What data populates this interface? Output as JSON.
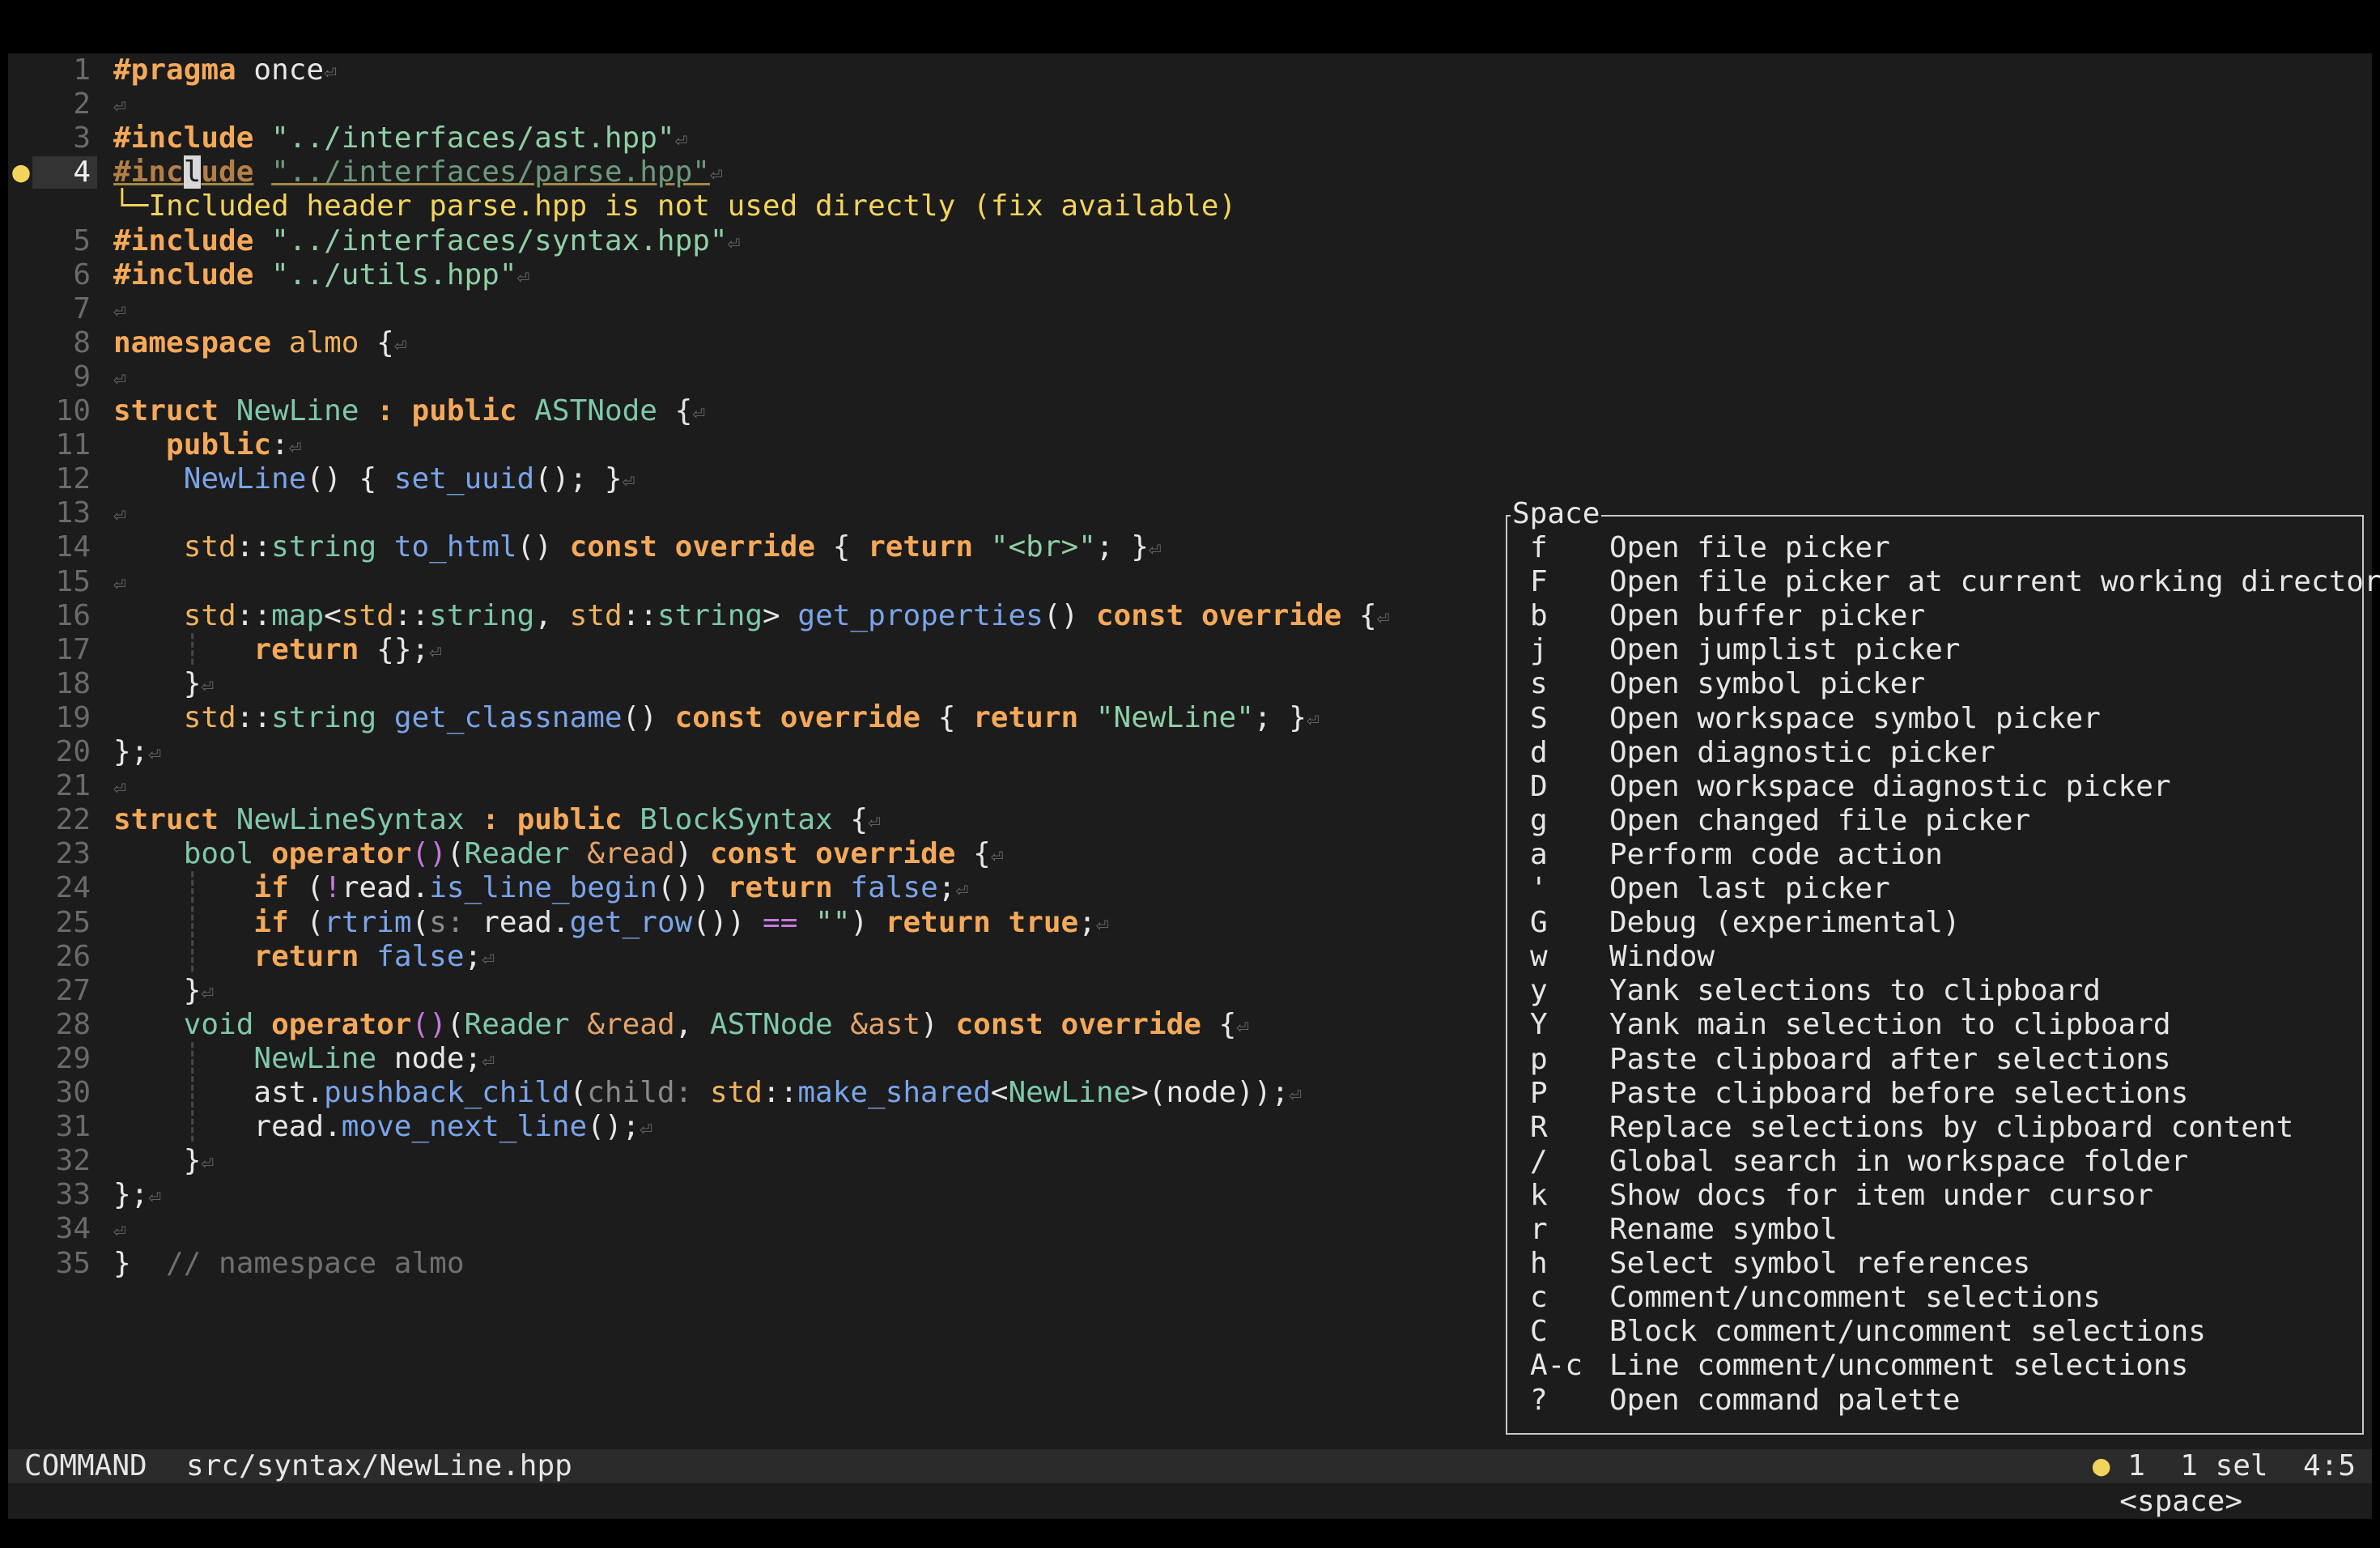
{
  "editor": {
    "current_line": "4",
    "diagnostic_marker": "●",
    "diagnostic_message": "└─Included header parse.hpp is not used directly (fix available)",
    "eol_symbol": "⏎"
  },
  "code_lines": [
    {
      "n": "1",
      "tokens": [
        [
          "kw",
          "#pragma"
        ],
        [
          "pl",
          " once"
        ]
      ]
    },
    {
      "n": "2",
      "tokens": []
    },
    {
      "n": "3",
      "tokens": [
        [
          "kw",
          "#include"
        ],
        [
          "pl",
          " "
        ],
        [
          "st",
          "\"../interfaces/ast.hpp\""
        ]
      ]
    },
    {
      "n": "4",
      "tokens": [
        [
          "kw dim ul",
          "#inc"
        ],
        [
          "cursor",
          "l"
        ],
        [
          "kw dim ul",
          "ude"
        ],
        [
          "pl",
          " "
        ],
        [
          "st dim ul",
          "\"../interfaces/parse.hpp\""
        ]
      ]
    },
    {
      "n": "5",
      "tokens": [
        [
          "kw",
          "#include"
        ],
        [
          "pl",
          " "
        ],
        [
          "st",
          "\"../interfaces/syntax.hpp\""
        ]
      ]
    },
    {
      "n": "6",
      "tokens": [
        [
          "kw",
          "#include"
        ],
        [
          "pl",
          " "
        ],
        [
          "st",
          "\"../utils.hpp\""
        ]
      ]
    },
    {
      "n": "7",
      "tokens": []
    },
    {
      "n": "8",
      "tokens": [
        [
          "kw",
          "namespace"
        ],
        [
          "pl",
          " "
        ],
        [
          "ns",
          "almo"
        ],
        [
          "pl",
          " {"
        ]
      ]
    },
    {
      "n": "9",
      "tokens": []
    },
    {
      "n": "10",
      "tokens": [
        [
          "kw",
          "struct"
        ],
        [
          "pl",
          " "
        ],
        [
          "ty",
          "NewLine"
        ],
        [
          "pl",
          " "
        ],
        [
          "kw",
          ":"
        ],
        [
          "pl",
          " "
        ],
        [
          "kw",
          "public"
        ],
        [
          "pl",
          " "
        ],
        [
          "ty",
          "ASTNode"
        ],
        [
          "pl",
          " {"
        ]
      ]
    },
    {
      "n": "11",
      "tokens": [
        [
          "pl",
          "   "
        ],
        [
          "kw",
          "public"
        ],
        [
          "pl",
          ":"
        ]
      ]
    },
    {
      "n": "12",
      "tokens": [
        [
          "pl",
          "    "
        ],
        [
          "fn",
          "NewLine"
        ],
        [
          "pl",
          "() { "
        ],
        [
          "fn",
          "set_uuid"
        ],
        [
          "pl",
          "(); }"
        ]
      ]
    },
    {
      "n": "13",
      "tokens": []
    },
    {
      "n": "14",
      "tokens": [
        [
          "pl",
          "    "
        ],
        [
          "ns",
          "std"
        ],
        [
          "pl",
          "::"
        ],
        [
          "ty",
          "string"
        ],
        [
          "pl",
          " "
        ],
        [
          "fn",
          "to_html"
        ],
        [
          "pl",
          "() "
        ],
        [
          "kw",
          "const"
        ],
        [
          "pl",
          " "
        ],
        [
          "kw",
          "override"
        ],
        [
          "pl",
          " { "
        ],
        [
          "kw",
          "return"
        ],
        [
          "pl",
          " "
        ],
        [
          "st",
          "\"<br>\""
        ],
        [
          "pl",
          "; }"
        ]
      ]
    },
    {
      "n": "15",
      "tokens": []
    },
    {
      "n": "16",
      "tokens": [
        [
          "pl",
          "    "
        ],
        [
          "ns",
          "std"
        ],
        [
          "pl",
          "::"
        ],
        [
          "ty",
          "map"
        ],
        [
          "pl",
          "<"
        ],
        [
          "ns",
          "std"
        ],
        [
          "pl",
          "::"
        ],
        [
          "ty",
          "string"
        ],
        [
          "pl",
          ", "
        ],
        [
          "ns",
          "std"
        ],
        [
          "pl",
          "::"
        ],
        [
          "ty",
          "string"
        ],
        [
          "pl",
          "> "
        ],
        [
          "fn",
          "get_properties"
        ],
        [
          "pl",
          "() "
        ],
        [
          "kw",
          "const"
        ],
        [
          "pl",
          " "
        ],
        [
          "kw",
          "override"
        ],
        [
          "pl",
          " {"
        ]
      ]
    },
    {
      "n": "17",
      "tokens": [
        [
          "pl",
          "    "
        ],
        [
          "guide",
          "┊"
        ],
        [
          "pl",
          "   "
        ],
        [
          "kw",
          "return"
        ],
        [
          "pl",
          " {};"
        ]
      ]
    },
    {
      "n": "18",
      "tokens": [
        [
          "pl",
          "    }"
        ]
      ]
    },
    {
      "n": "19",
      "tokens": [
        [
          "pl",
          "    "
        ],
        [
          "ns",
          "std"
        ],
        [
          "pl",
          "::"
        ],
        [
          "ty",
          "string"
        ],
        [
          "pl",
          " "
        ],
        [
          "fn",
          "get_classname"
        ],
        [
          "pl",
          "() "
        ],
        [
          "kw",
          "const"
        ],
        [
          "pl",
          " "
        ],
        [
          "kw",
          "override"
        ],
        [
          "pl",
          " { "
        ],
        [
          "kw",
          "return"
        ],
        [
          "pl",
          " "
        ],
        [
          "st",
          "\"NewLine\""
        ],
        [
          "pl",
          "; }"
        ]
      ]
    },
    {
      "n": "20",
      "tokens": [
        [
          "pl",
          "};"
        ]
      ]
    },
    {
      "n": "21",
      "tokens": []
    },
    {
      "n": "22",
      "tokens": [
        [
          "kw",
          "struct"
        ],
        [
          "pl",
          " "
        ],
        [
          "ty",
          "NewLineSyntax"
        ],
        [
          "pl",
          " "
        ],
        [
          "kw",
          ":"
        ],
        [
          "pl",
          " "
        ],
        [
          "kw",
          "public"
        ],
        [
          "pl",
          " "
        ],
        [
          "ty",
          "BlockSyntax"
        ],
        [
          "pl",
          " {"
        ]
      ]
    },
    {
      "n": "23",
      "tokens": [
        [
          "pl",
          "    "
        ],
        [
          "ty",
          "bool"
        ],
        [
          "pl",
          " "
        ],
        [
          "kw",
          "operator"
        ],
        [
          "op",
          "()"
        ],
        [
          "pl",
          "("
        ],
        [
          "ty",
          "Reader"
        ],
        [
          "pl",
          " "
        ],
        [
          "pm",
          "&read"
        ],
        [
          "pl",
          ") "
        ],
        [
          "kw",
          "const"
        ],
        [
          "pl",
          " "
        ],
        [
          "kw",
          "override"
        ],
        [
          "pl",
          " {"
        ]
      ]
    },
    {
      "n": "24",
      "tokens": [
        [
          "pl",
          "    "
        ],
        [
          "guide",
          "┊"
        ],
        [
          "pl",
          "   "
        ],
        [
          "kw",
          "if"
        ],
        [
          "pl",
          " ("
        ],
        [
          "op",
          "!"
        ],
        [
          "pl",
          "read."
        ],
        [
          "fn",
          "is_line_begin"
        ],
        [
          "pl",
          "()) "
        ],
        [
          "kw",
          "return"
        ],
        [
          "pl",
          " "
        ],
        [
          "fn",
          "false"
        ],
        [
          "pl",
          ";"
        ]
      ]
    },
    {
      "n": "25",
      "tokens": [
        [
          "pl",
          "    "
        ],
        [
          "guide",
          "┊"
        ],
        [
          "pl",
          "   "
        ],
        [
          "kw",
          "if"
        ],
        [
          "pl",
          " ("
        ],
        [
          "fn",
          "rtrim"
        ],
        [
          "pl",
          "("
        ],
        [
          "hint",
          "s: "
        ],
        [
          "pl",
          "read."
        ],
        [
          "fn",
          "get_row"
        ],
        [
          "pl",
          "()) "
        ],
        [
          "op",
          "=="
        ],
        [
          "pl",
          " "
        ],
        [
          "st",
          "\"\""
        ],
        [
          "pl",
          ") "
        ],
        [
          "kw",
          "return"
        ],
        [
          "pl",
          " "
        ],
        [
          "kw",
          "true"
        ],
        [
          "pl",
          ";"
        ]
      ]
    },
    {
      "n": "26",
      "tokens": [
        [
          "pl",
          "    "
        ],
        [
          "guide",
          "┊"
        ],
        [
          "pl",
          "   "
        ],
        [
          "kw",
          "return"
        ],
        [
          "pl",
          " "
        ],
        [
          "fn",
          "false"
        ],
        [
          "pl",
          ";"
        ]
      ]
    },
    {
      "n": "27",
      "tokens": [
        [
          "pl",
          "    }"
        ]
      ]
    },
    {
      "n": "28",
      "tokens": [
        [
          "pl",
          "    "
        ],
        [
          "ty",
          "void"
        ],
        [
          "pl",
          " "
        ],
        [
          "kw",
          "operator"
        ],
        [
          "op",
          "()"
        ],
        [
          "pl",
          "("
        ],
        [
          "ty",
          "Reader"
        ],
        [
          "pl",
          " "
        ],
        [
          "pm",
          "&read"
        ],
        [
          "pl",
          ", "
        ],
        [
          "ty",
          "ASTNode"
        ],
        [
          "pl",
          " "
        ],
        [
          "pm",
          "&ast"
        ],
        [
          "pl",
          ") "
        ],
        [
          "kw",
          "const"
        ],
        [
          "pl",
          " "
        ],
        [
          "kw",
          "override"
        ],
        [
          "pl",
          " {"
        ]
      ]
    },
    {
      "n": "29",
      "tokens": [
        [
          "pl",
          "    "
        ],
        [
          "guide",
          "┊"
        ],
        [
          "pl",
          "   "
        ],
        [
          "ty",
          "NewLine"
        ],
        [
          "pl",
          " node;"
        ]
      ]
    },
    {
      "n": "30",
      "tokens": [
        [
          "pl",
          "    "
        ],
        [
          "guide",
          "┊"
        ],
        [
          "pl",
          "   ast."
        ],
        [
          "fn",
          "pushback_child"
        ],
        [
          "pl",
          "("
        ],
        [
          "hint",
          "child: "
        ],
        [
          "ns",
          "std"
        ],
        [
          "pl",
          "::"
        ],
        [
          "fn",
          "make_shared"
        ],
        [
          "pl",
          "<"
        ],
        [
          "ty",
          "NewLine"
        ],
        [
          "pl",
          ">(node));"
        ]
      ]
    },
    {
      "n": "31",
      "tokens": [
        [
          "pl",
          "    "
        ],
        [
          "guide",
          "┊"
        ],
        [
          "pl",
          "   read."
        ],
        [
          "fn",
          "move_next_line"
        ],
        [
          "pl",
          "();"
        ]
      ]
    },
    {
      "n": "32",
      "tokens": [
        [
          "pl",
          "    }"
        ]
      ]
    },
    {
      "n": "33",
      "tokens": [
        [
          "pl",
          "};"
        ]
      ]
    },
    {
      "n": "34",
      "tokens": []
    },
    {
      "n": "35",
      "tokens": [
        [
          "pl",
          "}  "
        ],
        [
          "cm",
          "// namespace almo"
        ]
      ],
      "no_eol": true
    }
  ],
  "space_menu": {
    "title": "Space",
    "items": [
      {
        "key": "f",
        "label": "Open file picker"
      },
      {
        "key": "F",
        "label": "Open file picker at current working directory"
      },
      {
        "key": "b",
        "label": "Open buffer picker"
      },
      {
        "key": "j",
        "label": "Open jumplist picker"
      },
      {
        "key": "s",
        "label": "Open symbol picker"
      },
      {
        "key": "S",
        "label": "Open workspace symbol picker"
      },
      {
        "key": "d",
        "label": "Open diagnostic picker"
      },
      {
        "key": "D",
        "label": "Open workspace diagnostic picker"
      },
      {
        "key": "g",
        "label": "Open changed file picker"
      },
      {
        "key": "a",
        "label": "Perform code action"
      },
      {
        "key": "'",
        "label": "Open last picker"
      },
      {
        "key": "G",
        "label": "Debug (experimental)"
      },
      {
        "key": "w",
        "label": "Window"
      },
      {
        "key": "y",
        "label": "Yank selections to clipboard"
      },
      {
        "key": "Y",
        "label": "Yank main selection to clipboard"
      },
      {
        "key": "p",
        "label": "Paste clipboard after selections"
      },
      {
        "key": "P",
        "label": "Paste clipboard before selections"
      },
      {
        "key": "R",
        "label": "Replace selections by clipboard content"
      },
      {
        "key": "/",
        "label": "Global search in workspace folder"
      },
      {
        "key": "k",
        "label": "Show docs for item under cursor"
      },
      {
        "key": "r",
        "label": "Rename symbol"
      },
      {
        "key": "h",
        "label": "Select symbol references"
      },
      {
        "key": "c",
        "label": "Comment/uncomment selections"
      },
      {
        "key": "C",
        "label": "Block comment/uncomment selections"
      },
      {
        "key": "A-c",
        "label": "Line comment/uncomment selections"
      },
      {
        "key": "?",
        "label": "Open command palette"
      }
    ]
  },
  "statusbar": {
    "mode": "COMMAND",
    "file_path": "src/syntax/NewLine.hpp",
    "diag_dot": "●",
    "diag_count": "1",
    "selections": "1 sel",
    "cursor_position": "4:5"
  },
  "commandline": {
    "pending_keys": "<space>"
  },
  "colors": {
    "background": "#1c1c1c",
    "keyword": "#f4a95a",
    "type": "#7fc8a8",
    "function": "#7aa4e8",
    "string": "#8fcfa4",
    "warning": "#f2d45c",
    "statusbar": "#2b2b2b"
  }
}
